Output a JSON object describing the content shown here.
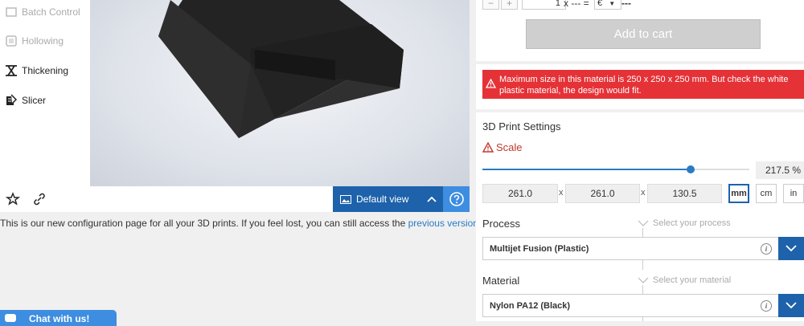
{
  "sidebar": {
    "items": [
      {
        "label": "Batch Control",
        "icon": "batch-control-icon",
        "disabled": true
      },
      {
        "label": "Hollowing",
        "icon": "hollowing-icon",
        "disabled": true
      },
      {
        "label": "Thickening",
        "icon": "thickening-icon",
        "disabled": false
      },
      {
        "label": "Slicer",
        "icon": "slicer-icon",
        "disabled": false
      }
    ]
  },
  "viewer": {
    "view_label": "Default view",
    "model_color": "#262626"
  },
  "info": {
    "text": "This is our new configuration page for all your 3D prints. If you feel lost, you can still access the",
    "link": "previous version"
  },
  "chat": {
    "label": "Chat with us!"
  },
  "order": {
    "minus": "−",
    "plus": "+",
    "quantity": "1",
    "equals": "x --- =",
    "currency": "€",
    "currency_arrow": "▼",
    "price": "---",
    "add_to_cart": "Add to cart"
  },
  "alert": {
    "message": "Maximum size in this material is 250 x 250 x 250 mm. But check the white plastic material, the design would fit.",
    "color": "#e53237"
  },
  "settings": {
    "title": "3D Print Settings",
    "scale_label": "Scale",
    "scale_value": "217.5",
    "scale_unit": "%",
    "scale_fraction": 0.78,
    "dims": [
      "261.0",
      "261.0",
      "130.5"
    ],
    "dim_separator": "x",
    "units": [
      "mm",
      "cm",
      "in"
    ],
    "active_unit": "mm"
  },
  "process": {
    "label": "Process",
    "placeholder": "Select your process",
    "value": "Multijet Fusion (Plastic)",
    "info": "i"
  },
  "material": {
    "label": "Material",
    "placeholder": "Select your material",
    "value": "Nylon PA12 (Black)",
    "info": "i"
  },
  "colors": {
    "accent": "#1d62ab",
    "link": "#2a7bc4",
    "help": "#3d8de0"
  }
}
